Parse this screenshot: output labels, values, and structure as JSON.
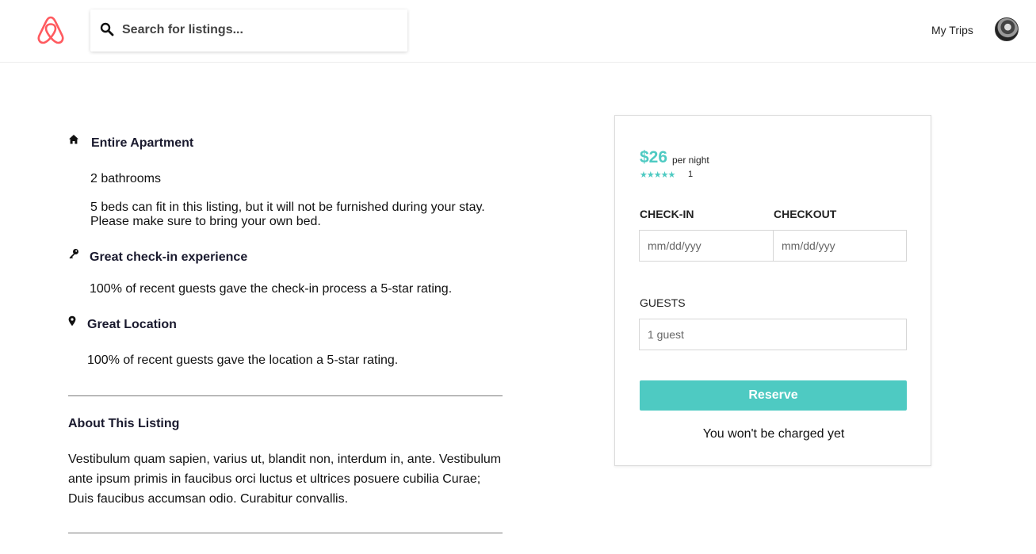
{
  "header": {
    "logo_icon": "airbnb-logo-icon",
    "search": {
      "placeholder": "Search for listings...",
      "icon": "search-icon"
    },
    "nav_trips": "My Trips",
    "avatar": "user-avatar"
  },
  "features": [
    {
      "icon": "home-icon",
      "title": "Entire Apartment",
      "lines": [
        "2 bathrooms",
        "5 beds can fit in this listing, but it will not be furnished during your stay. Please make sure to bring your own bed."
      ]
    },
    {
      "icon": "key-icon",
      "title": "Great check-in experience",
      "lines": [
        "100% of recent guests gave the check-in process a 5-star rating."
      ]
    },
    {
      "icon": "location-pin-icon",
      "title": "Great Location",
      "lines": [
        "100% of recent guests gave the location a 5-star rating."
      ]
    }
  ],
  "about": {
    "title": "About This Listing",
    "text": "Vestibulum quam sapien, varius ut, blandit non, interdum in, ante. Vestibulum ante ipsum primis in faucibus orci luctus et ultrices posuere cubilia Curae; Duis faucibus accumsan odio. Curabitur convallis."
  },
  "booking": {
    "price": "$26",
    "per_night": "per night",
    "rating": 5,
    "stars": "★★★★★",
    "review_count": "1",
    "checkin_label": "CHECK-IN",
    "checkout_label": "CHECKOUT",
    "checkin_placeholder": "mm/dd/yyy",
    "checkout_placeholder": "mm/dd/yyy",
    "guests_label": "GUESTS",
    "guests_placeholder": "1 guest",
    "reserve_label": "Reserve",
    "note": "You won't be charged yet"
  },
  "colors": {
    "accent": "#4ecac2",
    "brand": "#ff5a5f"
  }
}
